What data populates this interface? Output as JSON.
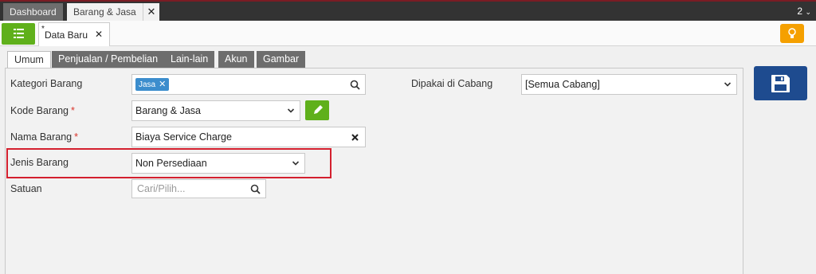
{
  "window": {
    "tabs": [
      "Dashboard",
      "Barang & Jasa"
    ],
    "close_glyph": "✕",
    "count": "2"
  },
  "toolbar": {
    "doc_tab_marker": "*",
    "doc_tab_label": "Data Baru",
    "doc_tab_close": "✕"
  },
  "form_tabs": [
    "Umum",
    "Penjualan / Pembelian",
    "Lain-lain",
    "Akun",
    "Gambar"
  ],
  "form": {
    "kategori": {
      "label": "Kategori Barang",
      "chip": "Jasa"
    },
    "kode": {
      "label": "Kode Barang",
      "value": "Barang & Jasa"
    },
    "nama": {
      "label": "Nama Barang",
      "value": "Biaya Service Charge"
    },
    "jenis": {
      "label": "Jenis Barang",
      "value": "Non Persediaan"
    },
    "satuan": {
      "label": "Satuan",
      "placeholder": "Cari/Pilih..."
    },
    "cabang": {
      "label": "Dipakai di Cabang",
      "value": "[Semua Cabang]"
    },
    "required_mark": "*"
  },
  "colors": {
    "green": "#5fb01b",
    "orange": "#f5a000",
    "navy": "#1e4b8f",
    "chip_blue": "#3c8dcd",
    "highlight_red": "#d4202e",
    "tab_gray": "#6d6d6d"
  },
  "icons": [
    "list-icon",
    "close-icon",
    "lightbulb-icon",
    "search-icon",
    "chevron-down-icon",
    "pencil-icon",
    "clear-icon",
    "save-disk-icon"
  ]
}
